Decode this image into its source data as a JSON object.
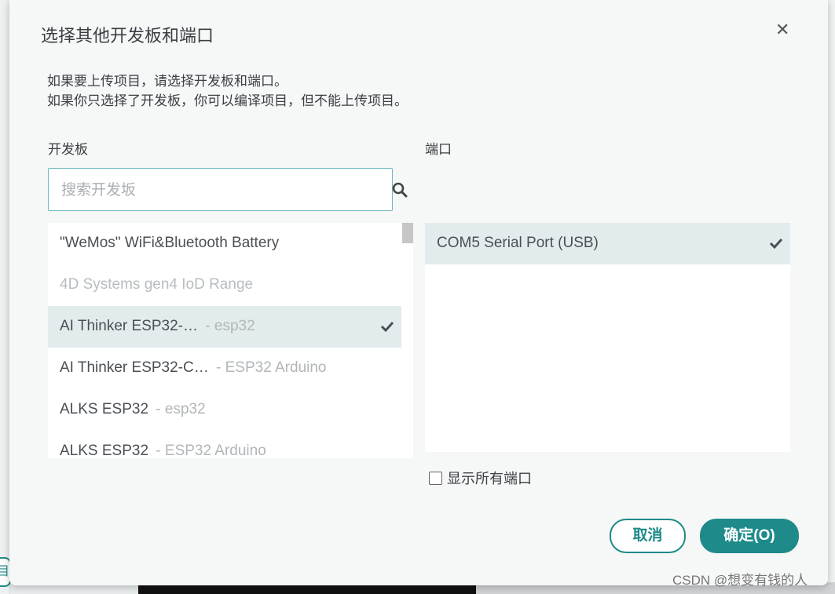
{
  "dialog": {
    "title": "选择其他开发板和端口",
    "description_line1": "如果要上传项目，请选择开发板和端口。",
    "description_line2": "如果你只选择了开发板，你可以编译项目，但不能上传项目。"
  },
  "boards": {
    "label": "开发板",
    "search_placeholder": "搜索开发坂",
    "items": [
      {
        "name": "\"WeMos\" WiFi&Bluetooth Battery",
        "sub": ""
      },
      {
        "name": "4D Systems gen4 IoD Range",
        "sub": ""
      },
      {
        "name": "AI Thinker ESP32-…",
        "sub": " - esp32"
      },
      {
        "name": "AI Thinker ESP32-C…",
        "sub": " - ESP32 Arduino"
      },
      {
        "name": "ALKS ESP32",
        "sub": " - esp32"
      },
      {
        "name": "ALKS ESP32",
        "sub": " - ESP32 Arduino"
      }
    ]
  },
  "ports": {
    "label": "端口",
    "items": [
      {
        "name": "COM5 Serial Port (USB)"
      }
    ],
    "show_all_label": "显示所有端口"
  },
  "buttons": {
    "cancel": "取消",
    "ok": "确定(O)"
  },
  "watermark": "CSDN @想变有钱的人",
  "colors": {
    "accent": "#1e8a8a",
    "selected_row": "#e3ecec",
    "disabled_text": "#b8bdc0"
  }
}
